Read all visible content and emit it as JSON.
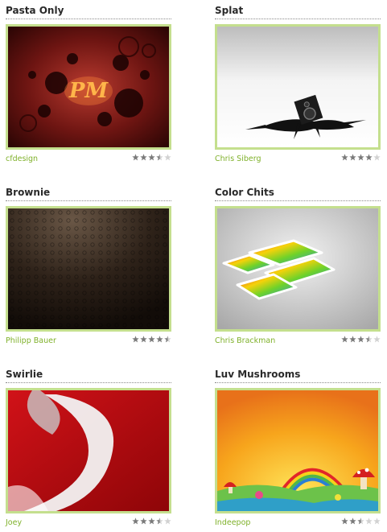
{
  "colors": {
    "frame": "#c4df8e",
    "author": "#7fb12a",
    "star_on": "#7a7a7a",
    "star_off": "#d2d2d2"
  },
  "star_icon": "star-icon",
  "wallpapers": [
    {
      "title": "Pasta Only",
      "author": "cfdesign",
      "rating": 3.5,
      "thumb_text": "PM"
    },
    {
      "title": "Splat",
      "author": "Chris Siberg",
      "rating": 4
    },
    {
      "title": "Brownie",
      "author": "Philipp Bauer",
      "rating": 4.5
    },
    {
      "title": "Color Chits",
      "author": "Chris Brackman",
      "rating": 3.5
    },
    {
      "title": "Swirlie",
      "author": "Joey",
      "rating": 3.5
    },
    {
      "title": "Luv Mushrooms",
      "author": "Indeepop",
      "rating": 2.5
    }
  ]
}
